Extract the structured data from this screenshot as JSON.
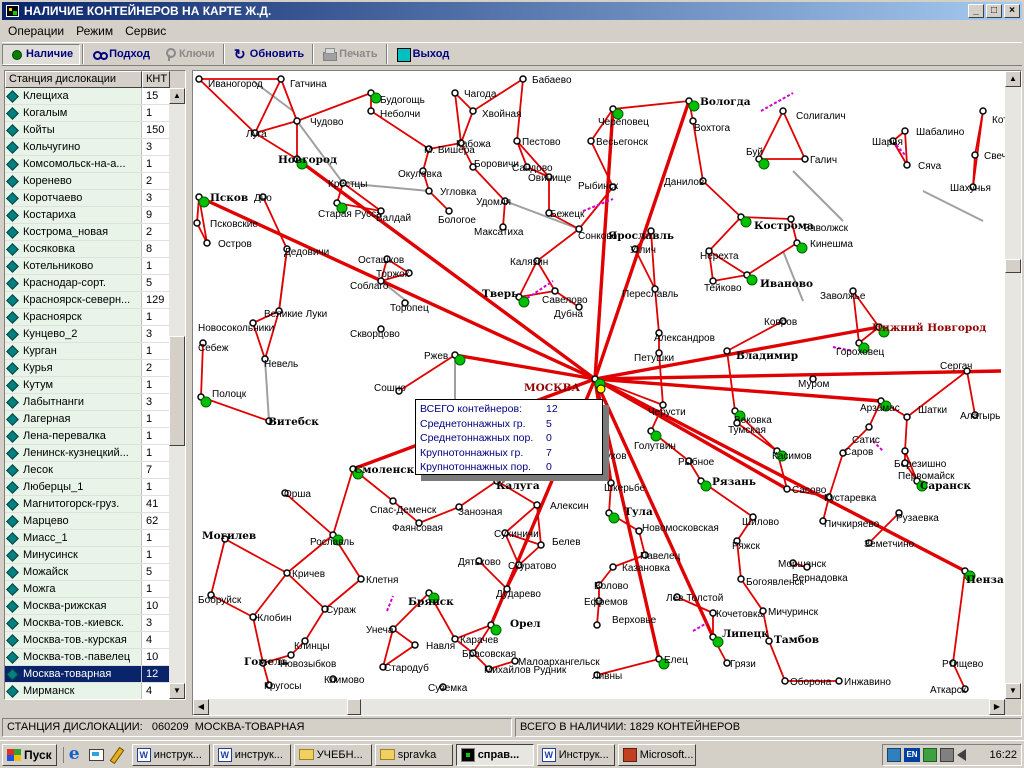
{
  "window": {
    "title": "НАЛИЧИЕ КОНТЕЙНЕРОВ НА КАРТЕ Ж.Д.",
    "minimize": "_",
    "maximize": "□",
    "close": "×"
  },
  "menu": [
    "Операции",
    "Режим",
    "Сервис"
  ],
  "toolbar": {
    "nalichie": "Наличие",
    "podhod": "Подход",
    "klyuchi": "Ключи",
    "obnovit": "Обновить",
    "pechat": "Печать",
    "vyhod": "Выход"
  },
  "station_list": {
    "col_name": "Станция дислокации",
    "col_count": "КНТ",
    "selected_index": 34,
    "rows": [
      {
        "name": "Клещиха",
        "count": "15"
      },
      {
        "name": "Когалым",
        "count": "1"
      },
      {
        "name": "Койты",
        "count": "150"
      },
      {
        "name": "Кольчугино",
        "count": "3"
      },
      {
        "name": "Комсомольск-на-а...",
        "count": "1"
      },
      {
        "name": "Коренево",
        "count": "2"
      },
      {
        "name": "Коротчаево",
        "count": "3"
      },
      {
        "name": "Костариха",
        "count": "9"
      },
      {
        "name": "Кострома_новая",
        "count": "2"
      },
      {
        "name": "Косяковка",
        "count": "8"
      },
      {
        "name": "Котельниково",
        "count": "1"
      },
      {
        "name": "Краснодар-сорт.",
        "count": "5"
      },
      {
        "name": "Красноярск-северн...",
        "count": "129"
      },
      {
        "name": "Красноярск",
        "count": "1"
      },
      {
        "name": "Кунцево_2",
        "count": "3"
      },
      {
        "name": "Курган",
        "count": "1"
      },
      {
        "name": "Курья",
        "count": "2"
      },
      {
        "name": "Кутум",
        "count": "1"
      },
      {
        "name": "Лабытнанги",
        "count": "3"
      },
      {
        "name": "Лагерная",
        "count": "1"
      },
      {
        "name": "Лена-перевалка",
        "count": "1"
      },
      {
        "name": "Ленинск-кузнецкий...",
        "count": "1"
      },
      {
        "name": "Лесок",
        "count": "7"
      },
      {
        "name": "Люберцы_1",
        "count": "1"
      },
      {
        "name": "Магнитогорск-груз.",
        "count": "41"
      },
      {
        "name": "Марцево",
        "count": "62"
      },
      {
        "name": "Миасс_1",
        "count": "1"
      },
      {
        "name": "Минусинск",
        "count": "1"
      },
      {
        "name": "Можайск",
        "count": "5"
      },
      {
        "name": "Можга",
        "count": "1"
      },
      {
        "name": "Москва-рижская",
        "count": "10"
      },
      {
        "name": "Москва-тов.-киевск.",
        "count": "3"
      },
      {
        "name": "Москва-тов.-курская",
        "count": "4"
      },
      {
        "name": "Москва-тов.-павелец",
        "count": "10"
      },
      {
        "name": "Москва-товарная",
        "count": "12"
      },
      {
        "name": "Мирманск",
        "count": "4"
      }
    ]
  },
  "map": {
    "route_color": "#e00000",
    "station_color": "#00c000",
    "cities": [
      {
        "name": "Иваногород",
        "bold": false
      },
      {
        "name": "Гатчина",
        "bold": false
      },
      {
        "name": "Будогощь",
        "bold": false
      },
      {
        "name": "Чагода",
        "bold": false
      },
      {
        "name": "Бабаево",
        "bold": false
      },
      {
        "name": "Вологда",
        "bold": true
      },
      {
        "name": "Неболчи",
        "bold": false
      },
      {
        "name": "Хвойная",
        "bold": false
      },
      {
        "name": "Череповец",
        "bold": false
      },
      {
        "name": "Вохтога",
        "bold": false
      },
      {
        "name": "Солигалич",
        "bold": false
      },
      {
        "name": "Шабалино",
        "bold": false
      },
      {
        "name": "Котельнич",
        "bold": false
      },
      {
        "name": "Луга",
        "bold": false
      },
      {
        "name": "Чудово",
        "bold": false
      },
      {
        "name": "Кабожа",
        "bold": false
      },
      {
        "name": "Пестово",
        "bold": false
      },
      {
        "name": "Весьегонск",
        "bold": false
      },
      {
        "name": "Шарья",
        "bold": false
      },
      {
        "name": "Свеча",
        "bold": false
      },
      {
        "name": "Новгород",
        "bold": true
      },
      {
        "name": "М. Вишера",
        "bold": false
      },
      {
        "name": "Боровичи",
        "bold": false
      },
      {
        "name": "Сандово",
        "bold": false
      },
      {
        "name": "Овинище",
        "bold": false
      },
      {
        "name": "Буй",
        "bold": false
      },
      {
        "name": "Галич",
        "bold": false
      },
      {
        "name": "Сяva",
        "bold": false
      },
      {
        "name": "Окуловка",
        "bold": false
      },
      {
        "name": "Данилов",
        "bold": false
      },
      {
        "name": "Шахунья",
        "bold": false
      },
      {
        "name": "Псков",
        "bold": true
      },
      {
        "name": "Дно",
        "bold": false
      },
      {
        "name": "Крестцы",
        "bold": false
      },
      {
        "name": "Угловка",
        "bold": false
      },
      {
        "name": "Рыбинск",
        "bold": false
      },
      {
        "name": "Удомля",
        "bold": false
      },
      {
        "name": "Бежецк",
        "bold": false
      },
      {
        "name": "Старая Русса",
        "bold": false
      },
      {
        "name": "Валдай",
        "bold": false
      },
      {
        "name": "Бологое",
        "bold": false
      },
      {
        "name": "Максатиха",
        "bold": false
      },
      {
        "name": "Сонково",
        "bold": false
      },
      {
        "name": "Ярославль",
        "bold": true
      },
      {
        "name": "Кострома",
        "bold": true
      },
      {
        "name": "Заволжск",
        "bold": false
      },
      {
        "name": "Кинешма",
        "bold": false
      },
      {
        "name": "Псковские",
        "bold": false
      },
      {
        "name": "Остров",
        "bold": false
      },
      {
        "name": "Дедовичи",
        "bold": false
      },
      {
        "name": "Осташков",
        "bold": false
      },
      {
        "name": "Калязин",
        "bold": false
      },
      {
        "name": "Углич",
        "bold": false
      },
      {
        "name": "Нерехта",
        "bold": false
      },
      {
        "name": "Иваново",
        "bold": true
      },
      {
        "name": "Торжок",
        "bold": false
      },
      {
        "name": "Тейково",
        "bold": false
      },
      {
        "name": "Соблаго",
        "bold": false
      },
      {
        "name": "Тверь",
        "bold": true
      },
      {
        "name": "Савелово",
        "bold": false
      },
      {
        "name": "Дубна",
        "bold": false
      },
      {
        "name": "Переславль",
        "bold": false
      },
      {
        "name": "Заволжье",
        "bold": false
      },
      {
        "name": "Нижний Новгород",
        "bold": true
      },
      {
        "name": "Великие Луки",
        "bold": false
      },
      {
        "name": "Торопец",
        "bold": false
      },
      {
        "name": "Новосокольники",
        "bold": false
      },
      {
        "name": "Скворцово",
        "bold": false
      },
      {
        "name": "Александров",
        "bold": false
      },
      {
        "name": "Ковров",
        "bold": false
      },
      {
        "name": "Себеж",
        "bold": false
      },
      {
        "name": "Ржев",
        "bold": false
      },
      {
        "name": "Петушки",
        "bold": false
      },
      {
        "name": "Владимир",
        "bold": true
      },
      {
        "name": "Гороховец",
        "bold": false
      },
      {
        "name": "Невель",
        "bold": false
      },
      {
        "name": "Сергач",
        "bold": false
      },
      {
        "name": "МОСКВА",
        "bold": true
      },
      {
        "name": "Муром",
        "bold": false
      },
      {
        "name": "Полоцк",
        "bold": false
      },
      {
        "name": "Сошно",
        "bold": false
      },
      {
        "name": "Черусти",
        "bold": false
      },
      {
        "name": "Арзамас",
        "bold": false
      },
      {
        "name": "Шатки",
        "bold": false
      },
      {
        "name": "Алатырь",
        "bold": false
      },
      {
        "name": "Витебск",
        "bold": true
      },
      {
        "name": "Вековка",
        "bold": false
      },
      {
        "name": "Тумская",
        "bold": false
      },
      {
        "name": "Голутвин",
        "bold": false
      },
      {
        "name": "Касимов",
        "bold": false
      },
      {
        "name": "Сатис",
        "bold": false
      },
      {
        "name": "Березишно",
        "bold": false
      },
      {
        "name": "Первомайск",
        "bold": false
      },
      {
        "name": "Серпухов",
        "bold": false
      },
      {
        "name": "Саров",
        "bold": false
      },
      {
        "name": "Смоленск",
        "bold": true
      },
      {
        "name": "Рыбное",
        "bold": false
      },
      {
        "name": "Калуга",
        "bold": true
      },
      {
        "name": "Шкерьбе",
        "bold": false
      },
      {
        "name": "Рязань",
        "bold": true
      },
      {
        "name": "Сасово",
        "bold": false
      },
      {
        "name": "Кустаревка",
        "bold": false
      },
      {
        "name": "Саранск",
        "bold": true
      },
      {
        "name": "Орша",
        "bold": false
      },
      {
        "name": "Спас-Деменск",
        "bold": false
      },
      {
        "name": "Алексин",
        "bold": false
      },
      {
        "name": "Тула",
        "bold": true
      },
      {
        "name": "Шилово",
        "bold": false
      },
      {
        "name": "Пичкиряево",
        "bold": false
      },
      {
        "name": "Рузаевка",
        "bold": false
      },
      {
        "name": "Фаянсовая",
        "bold": false
      },
      {
        "name": "Заноэная",
        "bold": false
      },
      {
        "name": "Новомосковская",
        "bold": false
      },
      {
        "name": "Могилев",
        "bold": true
      },
      {
        "name": "Рославль",
        "bold": false
      },
      {
        "name": "Сухиничи",
        "bold": false
      },
      {
        "name": "Белев",
        "bold": false
      },
      {
        "name": "Павелец",
        "bold": false
      },
      {
        "name": "Ряжск",
        "bold": false
      },
      {
        "name": "Земетчино",
        "bold": false
      },
      {
        "name": "Дятьково",
        "bold": false
      },
      {
        "name": "Скуратово",
        "bold": false
      },
      {
        "name": "Казановка",
        "bold": false
      },
      {
        "name": "Моршанск",
        "bold": false
      },
      {
        "name": "Пенза",
        "bold": true
      },
      {
        "name": "Кричев",
        "bold": false
      },
      {
        "name": "Клетня",
        "bold": false
      },
      {
        "name": "Дударево",
        "bold": false
      },
      {
        "name": "Волово",
        "bold": false
      },
      {
        "name": "Вернадовка",
        "bold": false
      },
      {
        "name": "Богоявленск",
        "bold": false
      },
      {
        "name": "Бобруйск",
        "bold": false
      },
      {
        "name": "Брянск",
        "bold": true
      },
      {
        "name": "Ефремов",
        "bold": false
      },
      {
        "name": "Лев Толстой",
        "bold": false
      },
      {
        "name": "Кочетовка",
        "bold": false
      },
      {
        "name": "Мичуринск",
        "bold": false
      },
      {
        "name": "Жлобин",
        "bold": false
      },
      {
        "name": "Сураж",
        "bold": false
      },
      {
        "name": "Унеча",
        "bold": false
      },
      {
        "name": "Орел",
        "bold": true
      },
      {
        "name": "Верховье",
        "bold": false
      },
      {
        "name": "Липецк",
        "bold": true
      },
      {
        "name": "Тамбов",
        "bold": true
      },
      {
        "name": "Клинцы",
        "bold": false
      },
      {
        "name": "Новозыбков",
        "bold": false
      },
      {
        "name": "Навля",
        "bold": false
      },
      {
        "name": "Карачев",
        "bold": false
      },
      {
        "name": "Гомель",
        "bold": true
      },
      {
        "name": "Стародуб",
        "bold": false
      },
      {
        "name": "Брасовская",
        "bold": false
      },
      {
        "name": "Малоархангельск",
        "bold": false
      },
      {
        "name": "Елец",
        "bold": false
      },
      {
        "name": "Грязи",
        "bold": false
      },
      {
        "name": "Ртищево",
        "bold": false
      },
      {
        "name": "Климово",
        "bold": false
      },
      {
        "name": "Михайлов Рудник",
        "bold": false
      },
      {
        "name": "Ливны",
        "bold": false
      },
      {
        "name": "Оборона",
        "bold": false
      },
      {
        "name": "Инжавино",
        "bold": false
      },
      {
        "name": "Кругосы",
        "bold": false
      },
      {
        "name": "Суземка",
        "bold": false
      },
      {
        "name": "Аткарск",
        "bold": false
      }
    ]
  },
  "tooltip": {
    "rows": [
      {
        "label": "ВСЕГО контейнеров:",
        "value": "12"
      },
      {
        "label": "Среднетоннажных гр.",
        "value": "5"
      },
      {
        "label": "Среднетоннажных пор.",
        "value": "0"
      },
      {
        "label": "Крупнотоннажных гр.",
        "value": "7"
      },
      {
        "label": "Крупнотоннажных пор.",
        "value": "0"
      }
    ]
  },
  "status": {
    "location_label": "СТАНЦИЯ ДИСЛОКАЦИИ:",
    "location_code": "060209",
    "location_name": "МОСКВА-ТОВАРНАЯ",
    "total": "ВСЕГО В НАЛИЧИИ: 1829 КОНТЕЙНЕРОВ"
  },
  "taskbar": {
    "start": "Пуск",
    "tasks": [
      {
        "label": "инструк...",
        "icon": "word",
        "active": false
      },
      {
        "label": "инструк...",
        "icon": "word",
        "active": false
      },
      {
        "label": "УЧЕБН...",
        "icon": "folder",
        "active": false
      },
      {
        "label": "spravka",
        "icon": "folder",
        "active": false
      },
      {
        "label": "справ...",
        "icon": "app",
        "active": true
      },
      {
        "label": "Инструк...",
        "icon": "word",
        "active": false
      },
      {
        "label": "Microsoft...",
        "icon": "ppt",
        "active": false
      }
    ],
    "lang": "EN",
    "clock": "16:22"
  }
}
